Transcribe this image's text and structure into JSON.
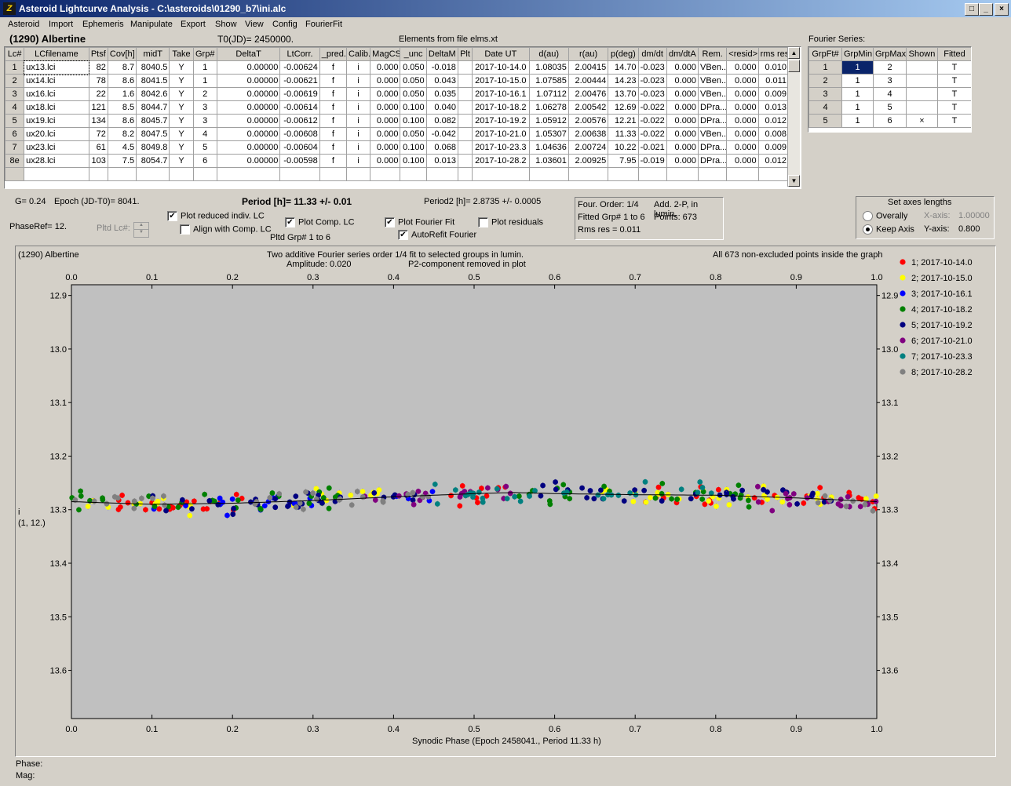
{
  "window": {
    "title": "Asteroid Lightcurve Analysis - C:\\asteroids\\01290_b7\\ini.alc",
    "icon_text": "Z"
  },
  "menu": [
    "Asteroid",
    "Import",
    "Ephemeris",
    "Manipulate",
    "Export",
    "Show",
    "View",
    "Config",
    "FourierFit"
  ],
  "header": {
    "asteroid_name": "(1290) Albertine",
    "t0": "T0(JD)= 2450000.",
    "elements": "Elements from file elms.xt",
    "fourier_title": "Fourier Series:"
  },
  "lc_table": {
    "columns": [
      "Lc#",
      "LCfilename",
      "Ptsf",
      "Cov[h]",
      "midT",
      "Take",
      "Grp#",
      "DeltaT",
      "LtCorr.",
      "_pred.",
      "Calib.",
      "MagCS",
      "_unc",
      "DeltaM",
      "Plt",
      "Date UT",
      "d(au)",
      "r(au)",
      "p(deg)",
      "dm/dt",
      "dm/dtA",
      "Rem.",
      "<resid>",
      "rms res"
    ],
    "rows": [
      [
        "1",
        "ux13.lci",
        "82",
        "8.7",
        "8040.5",
        "Y",
        "1",
        "0.00000",
        "-0.00624",
        "f",
        "i",
        "0.000",
        "0.050",
        "-0.018",
        "",
        "2017-10-14.0",
        "1.08035",
        "2.00415",
        "14.70",
        "-0.023",
        "0.000",
        "VBen...",
        "0.000",
        "0.010"
      ],
      [
        "2",
        "ux14.lci",
        "78",
        "8.6",
        "8041.5",
        "Y",
        "1",
        "0.00000",
        "-0.00621",
        "f",
        "i",
        "0.000",
        "0.050",
        "0.043",
        "",
        "2017-10-15.0",
        "1.07585",
        "2.00444",
        "14.23",
        "-0.023",
        "0.000",
        "VBen...",
        "0.000",
        "0.011"
      ],
      [
        "3",
        "ux16.lci",
        "22",
        "1.6",
        "8042.6",
        "Y",
        "2",
        "0.00000",
        "-0.00619",
        "f",
        "i",
        "0.000",
        "0.050",
        "0.035",
        "",
        "2017-10-16.1",
        "1.07112",
        "2.00476",
        "13.70",
        "-0.023",
        "0.000",
        "VBen...",
        "0.000",
        "0.009"
      ],
      [
        "4",
        "ux18.lci",
        "121",
        "8.5",
        "8044.7",
        "Y",
        "3",
        "0.00000",
        "-0.00614",
        "f",
        "i",
        "0.000",
        "0.100",
        "0.040",
        "",
        "2017-10-18.2",
        "1.06278",
        "2.00542",
        "12.69",
        "-0.022",
        "0.000",
        "DPra...",
        "0.000",
        "0.013"
      ],
      [
        "5",
        "ux19.lci",
        "134",
        "8.6",
        "8045.7",
        "Y",
        "3",
        "0.00000",
        "-0.00612",
        "f",
        "i",
        "0.000",
        "0.100",
        "0.082",
        "",
        "2017-10-19.2",
        "1.05912",
        "2.00576",
        "12.21",
        "-0.022",
        "0.000",
        "DPra...",
        "0.000",
        "0.012"
      ],
      [
        "6",
        "ux20.lci",
        "72",
        "8.2",
        "8047.5",
        "Y",
        "4",
        "0.00000",
        "-0.00608",
        "f",
        "i",
        "0.000",
        "0.050",
        "-0.042",
        "",
        "2017-10-21.0",
        "1.05307",
        "2.00638",
        "11.33",
        "-0.022",
        "0.000",
        "VBen...",
        "0.000",
        "0.008"
      ],
      [
        "7",
        "ux23.lci",
        "61",
        "4.5",
        "8049.8",
        "Y",
        "5",
        "0.00000",
        "-0.00604",
        "f",
        "i",
        "0.000",
        "0.100",
        "0.068",
        "",
        "2017-10-23.3",
        "1.04636",
        "2.00724",
        "10.22",
        "-0.021",
        "0.000",
        "DPra...",
        "0.000",
        "0.009"
      ],
      [
        "8e",
        "ux28.lci",
        "103",
        "7.5",
        "8054.7",
        "Y",
        "6",
        "0.00000",
        "-0.00598",
        "f",
        "i",
        "0.000",
        "0.100",
        "0.013",
        "",
        "2017-10-28.2",
        "1.03601",
        "2.00925",
        "7.95",
        "-0.019",
        "0.000",
        "DPra...",
        "0.000",
        "0.012"
      ]
    ]
  },
  "fourier_table": {
    "columns": [
      "GrpFt#",
      "GrpMin",
      "GrpMax",
      "Shown",
      "Fitted"
    ],
    "rows": [
      [
        "1",
        "1",
        "2",
        "",
        "T"
      ],
      [
        "2",
        "1",
        "3",
        "",
        "T"
      ],
      [
        "3",
        "1",
        "4",
        "",
        "T"
      ],
      [
        "4",
        "1",
        "5",
        "",
        "T"
      ],
      [
        "5",
        "1",
        "6",
        "×",
        "T"
      ]
    ]
  },
  "info": {
    "g": "G= 0.24",
    "epoch": "Epoch (JD-T0)= 8041.",
    "period": "Period [h]= 11.33 +/- 0.01",
    "period2": "Period2 [h]= 2.8735 +/- 0.0005",
    "phaseref": "PhaseRef= 12.",
    "pltd_lc": "Pltd Lc#:",
    "pltd_grp": "Pltd Grp#  1   to   6"
  },
  "options": {
    "plot_reduced": {
      "label": "Plot reduced indiv. LC",
      "checked": true
    },
    "align_comp": {
      "label": "Align with Comp. LC",
      "checked": false
    },
    "plot_comp": {
      "label": "Plot Comp. LC",
      "checked": true
    },
    "plot_fourier": {
      "label": "Plot Fourier Fit",
      "checked": true
    },
    "autorefit": {
      "label": "AutoRefit Fourier",
      "checked": true
    },
    "plot_residuals": {
      "label": "Plot residuals",
      "checked": false
    }
  },
  "fit_info": {
    "order": "Four. Order:  1/4",
    "add": "Add. 2-P, in lumin.",
    "fitted": "Fitted Grp# 1 to 6",
    "points": "Points: 673",
    "rms": "Rms res     = 0.011"
  },
  "axes_group": {
    "title": "Set axes lengths",
    "overally": "Overally",
    "keep_axis": "Keep Axis",
    "keep_axis_selected": true,
    "xaxis_label": "X-axis:",
    "xaxis_value": "1.00000",
    "yaxis_label": "Y-axis:",
    "yaxis_value": "0.800"
  },
  "plot": {
    "name": "(1290) Albertine",
    "subtitle1": "Two additive Fourier series order 1/4 fit to selected groups in lumin.",
    "subtitle2_left": "Amplitude: 0.020",
    "subtitle2_right": "P2-component removed in plot",
    "note": "All 673 non-excluded points inside the graph",
    "ylabel1": "i",
    "ylabel2": "(1, 12.)",
    "xlabel": "Synodic Phase (Epoch 2458041., Period 11.33 h)"
  },
  "status": {
    "phase": "Phase:",
    "mag": "Mag:"
  },
  "chart_data": {
    "type": "scatter",
    "title": "Two additive Fourier series order 1/4 fit to selected groups in lumin.",
    "xlabel": "Synodic Phase (Epoch 2458041., Period 11.33 h)",
    "ylabel": "i (1, 12.)",
    "xlim": [
      0.0,
      1.0
    ],
    "ylim": [
      13.69,
      12.88
    ],
    "y_inverted": true,
    "xticks": [
      "0.0",
      "0.1",
      "0.2",
      "0.3",
      "0.4",
      "0.5",
      "0.6",
      "0.7",
      "0.8",
      "0.9",
      "1.0"
    ],
    "yticks": [
      "12.9",
      "13.0",
      "13.1",
      "13.2",
      "13.3",
      "13.4",
      "13.5",
      "13.6"
    ],
    "grid": false,
    "legend_position": "right",
    "fit_curve": {
      "x": [
        0.0,
        0.1,
        0.2,
        0.3,
        0.4,
        0.5,
        0.55,
        0.6,
        0.7,
        0.8,
        0.9,
        1.0
      ],
      "y": [
        13.285,
        13.29,
        13.288,
        13.283,
        13.276,
        13.27,
        13.268,
        13.27,
        13.272,
        13.273,
        13.278,
        13.285
      ]
    },
    "series": [
      {
        "name": "1; 2017-10-14.0",
        "color": "#ff0000",
        "x_ranges": [
          [
            0.0,
            0.25
          ],
          [
            0.45,
            0.55
          ],
          [
            0.7,
            1.0
          ]
        ]
      },
      {
        "name": "2; 2017-10-15.0",
        "color": "#ffff00",
        "x_ranges": [
          [
            0.02,
            0.15
          ],
          [
            0.27,
            0.4
          ],
          [
            0.65,
            1.0
          ]
        ]
      },
      {
        "name": "3; 2017-10-16.1",
        "color": "#0000ff",
        "x_ranges": [
          [
            0.1,
            0.3
          ],
          [
            0.4,
            0.45
          ]
        ]
      },
      {
        "name": "4; 2017-10-18.2",
        "color": "#008000",
        "x_ranges": [
          [
            0.0,
            0.35
          ],
          [
            0.55,
            0.85
          ]
        ]
      },
      {
        "name": "5; 2017-10-19.2",
        "color": "#000080",
        "x_ranges": [
          [
            0.1,
            0.45
          ],
          [
            0.58,
            0.95
          ]
        ]
      },
      {
        "name": "6; 2017-10-21.0",
        "color": "#800080",
        "x_ranges": [
          [
            0.35,
            0.55
          ],
          [
            0.8,
            1.0
          ]
        ]
      },
      {
        "name": "7; 2017-10-23.3",
        "color": "#008080",
        "x_ranges": [
          [
            0.45,
            0.8
          ]
        ]
      },
      {
        "name": "8; 2017-10-28.2",
        "color": "#808080",
        "x_ranges": [
          [
            0.0,
            0.12
          ],
          [
            0.22,
            0.45
          ],
          [
            0.92,
            1.0
          ]
        ]
      }
    ],
    "y_center": 13.278,
    "y_spread": 0.03
  }
}
